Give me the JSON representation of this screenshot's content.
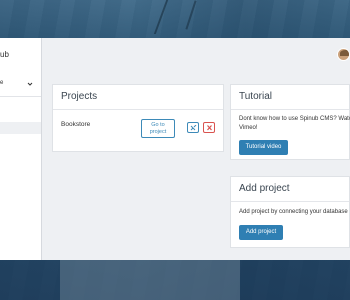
{
  "sidebar": {
    "title_fragment": "ub",
    "select_fragment": "e"
  },
  "projects_card": {
    "title": "Projects",
    "items": [
      {
        "name": "Bookstore",
        "goto_label": "Go to\nproject"
      }
    ]
  },
  "tutorial_card": {
    "title": "Tutorial",
    "text": "Dont know how to use Spinub CMS? Watch\nVimeo!",
    "button_label": "Tutorial video"
  },
  "add_project_card": {
    "title": "Add project",
    "text": "Add project by connecting your database",
    "button_label": "Add project"
  },
  "colors": {
    "primary": "#2f7fb3",
    "danger": "#d9534f",
    "background": "#eef0f3"
  }
}
